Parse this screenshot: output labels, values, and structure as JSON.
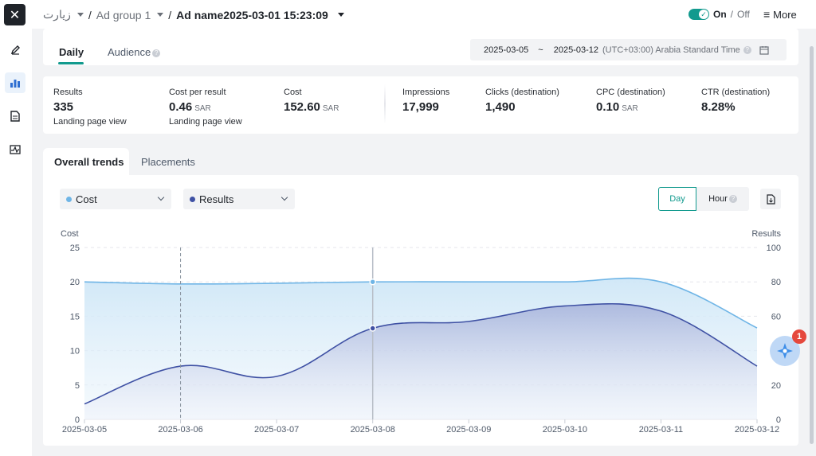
{
  "header": {
    "campaign": "زيارت",
    "ad_group": "Ad group 1",
    "ad_name": "Ad name2025-03-01 15:23:09",
    "separator": "/",
    "toggle_on": "On",
    "toggle_sep": "/",
    "toggle_off": "Off",
    "more_label": "More",
    "close_label": "✕"
  },
  "tabs": {
    "daily": "Daily",
    "audience": "Audience"
  },
  "date_range": {
    "start": "2025-03-05",
    "tilde": "~",
    "end": "2025-03-12",
    "timezone": "(UTC+03:00) Arabia Standard Time"
  },
  "metrics": [
    {
      "label": "Results",
      "value": "335",
      "unit": "",
      "sub": "Landing page view"
    },
    {
      "label": "Cost per result",
      "value": "0.46",
      "unit": "SAR",
      "sub": "Landing page view"
    },
    {
      "label": "Cost",
      "value": "152.60",
      "unit": "SAR",
      "sub": ""
    },
    {
      "label": "Impressions",
      "value": "17,999",
      "unit": "",
      "sub": ""
    },
    {
      "label": "Clicks (destination)",
      "value": "1,490",
      "unit": "",
      "sub": ""
    },
    {
      "label": "CPC (destination)",
      "value": "0.10",
      "unit": "SAR",
      "sub": ""
    },
    {
      "label": "CTR (destination)",
      "value": "8.28%",
      "unit": "",
      "sub": ""
    }
  ],
  "trend_tabs": {
    "overall": "Overall trends",
    "placements": "Placements"
  },
  "controls": {
    "metric1": "Cost",
    "metric2": "Results",
    "day": "Day",
    "hour": "Hour"
  },
  "colors": {
    "accent": "#129a8e",
    "cost": "#6fb5e6",
    "results": "#3f51a4",
    "badge": "#e5483d"
  },
  "assistant": {
    "badge": "1"
  },
  "chart_data": {
    "type": "area",
    "x": [
      "2025-03-05",
      "2025-03-06",
      "2025-03-07",
      "2025-03-08",
      "2025-03-09",
      "2025-03-10",
      "2025-03-11",
      "2025-03-12"
    ],
    "left_axis_label": "Cost",
    "right_axis_label": "Results",
    "left_ticks": [
      "0",
      "5",
      "10",
      "15",
      "20",
      "25"
    ],
    "right_ticks": [
      "0",
      "20",
      "40",
      "60",
      "80",
      "100"
    ],
    "ylim_left": [
      0,
      25
    ],
    "ylim_right": [
      0,
      100
    ],
    "series": [
      {
        "name": "Cost",
        "axis": "left",
        "values": [
          20.0,
          19.7,
          19.8,
          20.0,
          20.0,
          20.0,
          20.0,
          13.3
        ]
      },
      {
        "name": "Results",
        "axis": "right",
        "values": [
          9,
          31,
          25,
          53,
          57,
          66,
          63,
          31
        ]
      }
    ],
    "grid": true,
    "dashed_marker_x": "2025-03-06",
    "hover_x": "2025-03-08"
  }
}
